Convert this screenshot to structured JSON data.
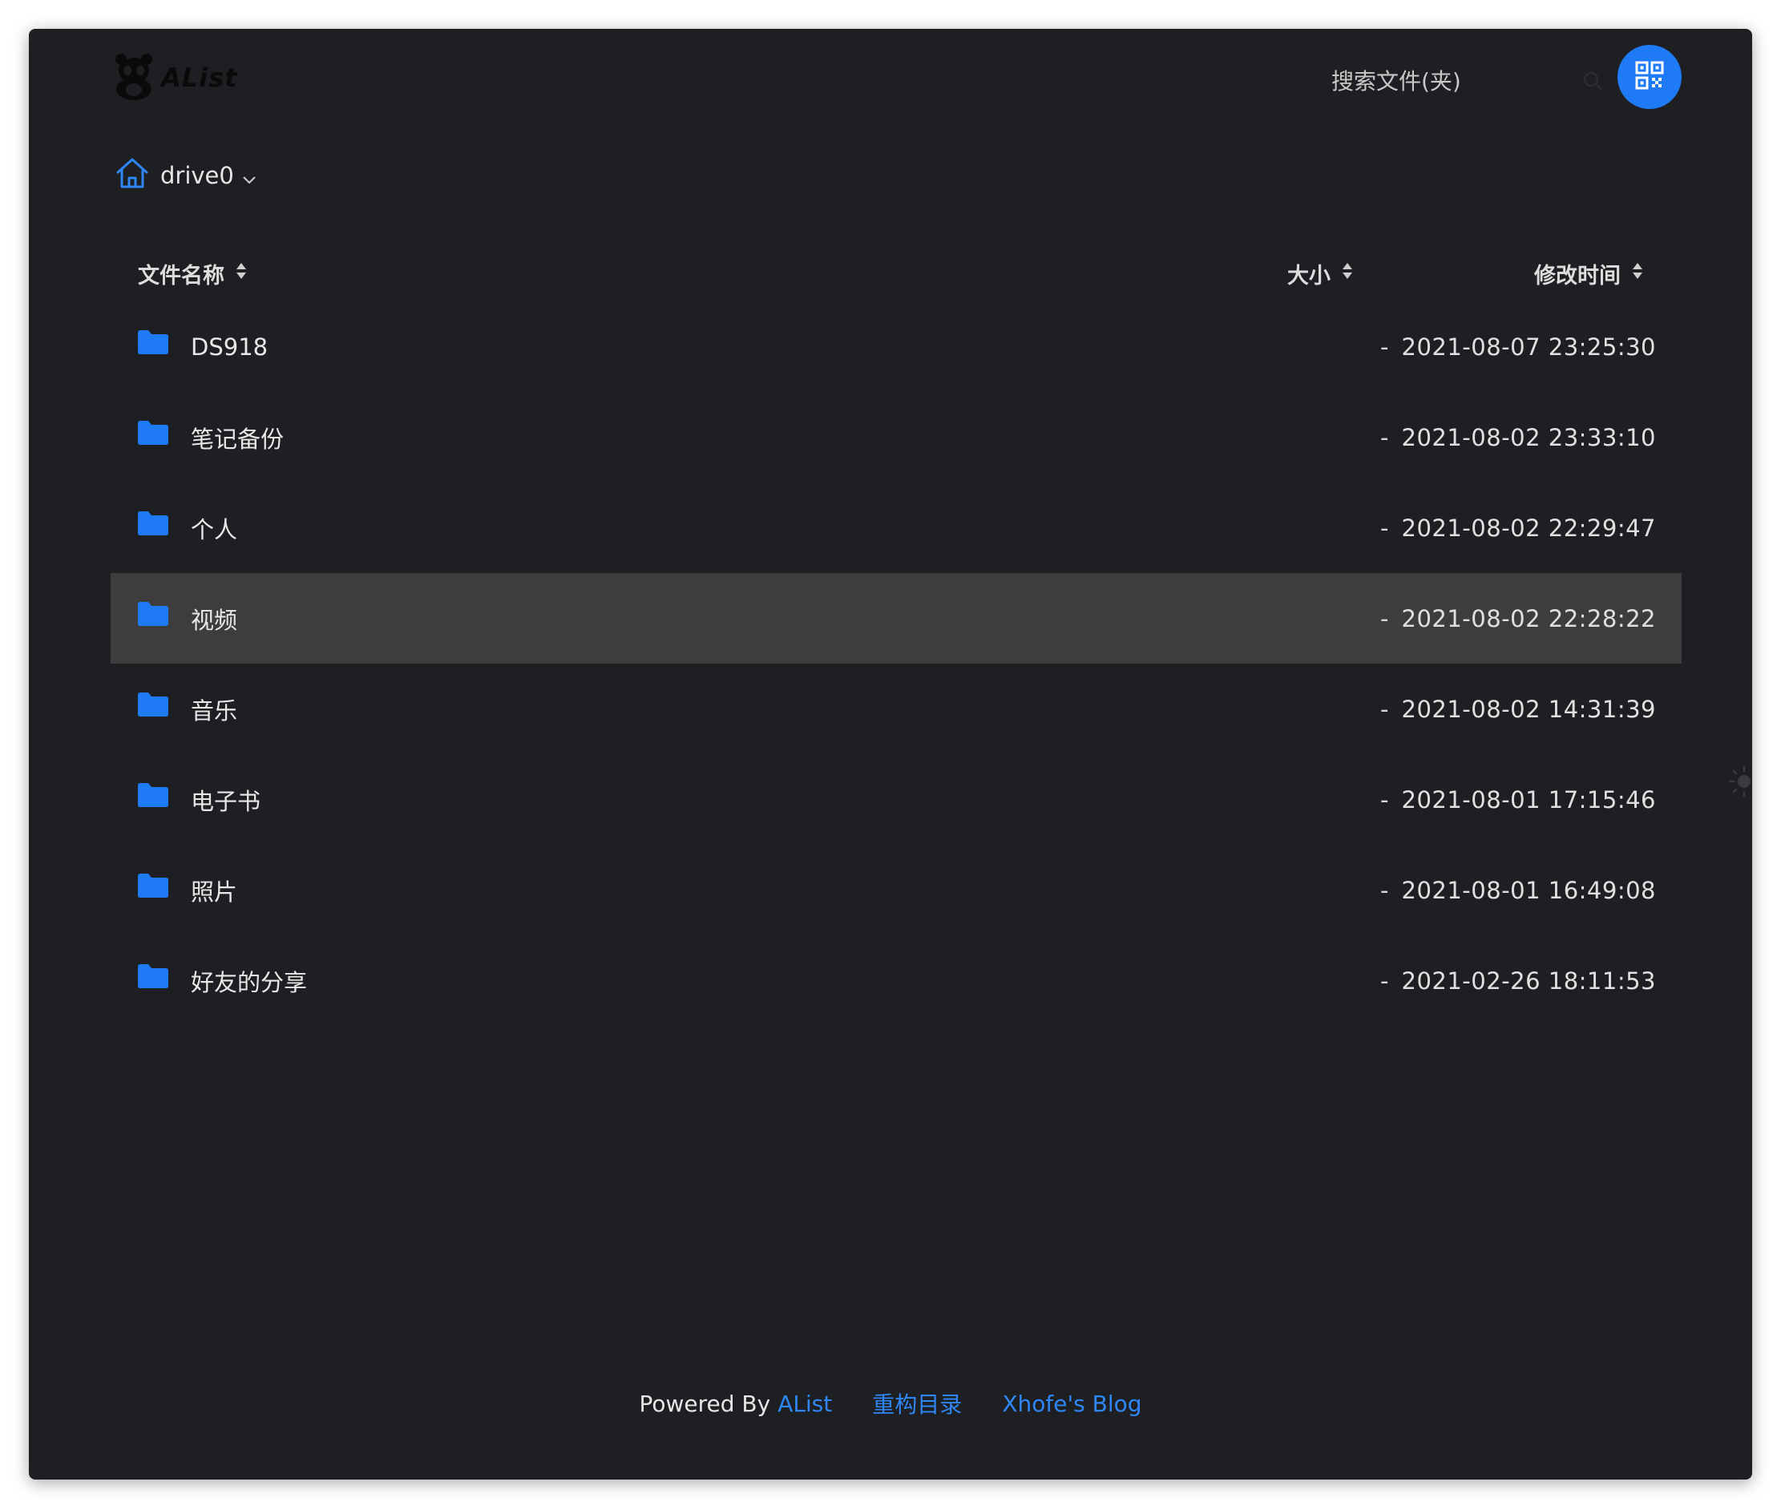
{
  "header": {
    "logo_text": "AList",
    "search_placeholder": "搜索文件(夹)"
  },
  "breadcrumb": {
    "drive_label": "drive0"
  },
  "table": {
    "columns": {
      "name": "文件名称",
      "size": "大小",
      "modified": "修改时间"
    },
    "rows": [
      {
        "name": "DS918",
        "size": "-",
        "modified": "2021-08-07 23:25:30"
      },
      {
        "name": "笔记备份",
        "size": "-",
        "modified": "2021-08-02 23:33:10"
      },
      {
        "name": "个人",
        "size": "-",
        "modified": "2021-08-02 22:29:47"
      },
      {
        "name": "视频",
        "size": "-",
        "modified": "2021-08-02 22:28:22"
      },
      {
        "name": "音乐",
        "size": "-",
        "modified": "2021-08-02 14:31:39"
      },
      {
        "name": "电子书",
        "size": "-",
        "modified": "2021-08-01 17:15:46"
      },
      {
        "name": "照片",
        "size": "-",
        "modified": "2021-08-01 16:49:08"
      },
      {
        "name": "好友的分享",
        "size": "-",
        "modified": "2021-02-26 18:11:53"
      }
    ],
    "hovered_row": 3
  },
  "footer": {
    "powered_by": "Powered By",
    "alist_link": "AList",
    "rebuild_link": "重构目录",
    "blog_link": "Xhofe's Blog"
  },
  "icons": {
    "logo": "panda-logo-icon",
    "search": "search-icon",
    "qr": "qr-code-icon",
    "home": "home-icon",
    "chevron": "chevron-down-icon",
    "sort": "sort-icon",
    "folder": "folder-icon",
    "theme": "sun-icon"
  },
  "colors": {
    "background": "#1e1f22",
    "accent": "#1e7af5",
    "row_hover": "#3d3d3e",
    "link": "#2f86f6"
  }
}
